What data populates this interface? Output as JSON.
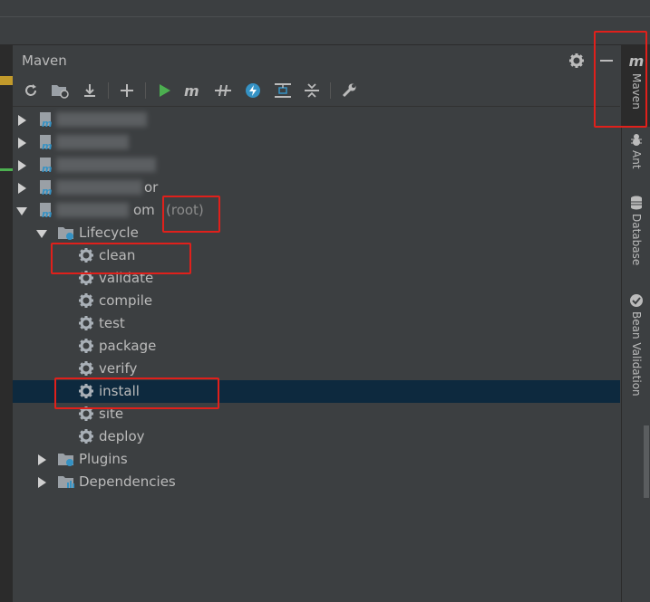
{
  "panel": {
    "title": "Maven"
  },
  "toolbar": {
    "buttons": [
      {
        "name": "reload-icon"
      },
      {
        "name": "generate-sources-icon"
      },
      {
        "name": "download-icon"
      },
      {
        "name": "add-icon"
      },
      {
        "name": "run-icon"
      },
      {
        "name": "execute-goal-icon"
      },
      {
        "name": "toggle-offline-icon"
      },
      {
        "name": "skip-tests-icon"
      },
      {
        "name": "show-dependencies-icon"
      },
      {
        "name": "collapse-all-icon"
      },
      {
        "name": "settings-wrench-icon"
      }
    ]
  },
  "tree": {
    "root_suffix": "(root)",
    "root_label_tail": "om",
    "module4_tail": "or",
    "lifecycle": {
      "label": "Lifecycle",
      "goals": [
        "clean",
        "validate",
        "compile",
        "test",
        "package",
        "verify",
        "install",
        "site",
        "deploy"
      ]
    },
    "plugins": "Plugins",
    "dependencies": "Dependencies"
  },
  "right_tabs": [
    {
      "label": "Maven",
      "icon": "maven-icon"
    },
    {
      "label": "Ant",
      "icon": "ant-icon"
    },
    {
      "label": "Database",
      "icon": "database-icon"
    },
    {
      "label": "Bean Validation",
      "icon": "bean-validation-icon"
    }
  ],
  "colors": {
    "background": "#3c3f41",
    "selection": "#0d293e",
    "run_green": "#4caf50",
    "accent_blue": "#3592c4",
    "highlight_red": "#e0201b"
  }
}
